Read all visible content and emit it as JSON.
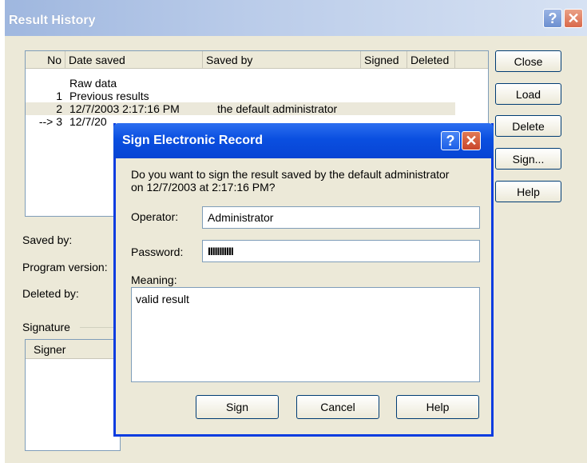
{
  "main_window": {
    "title": "Result History",
    "columns": [
      "No",
      "Date saved",
      "Saved by",
      "Signed",
      "Deleted"
    ],
    "rows": [
      {
        "no": "",
        "date": "Raw data",
        "saved_by": ""
      },
      {
        "no": "1",
        "date": "Previous results",
        "saved_by": ""
      },
      {
        "no": "2",
        "date": "12/7/2003 2:17:16 PM",
        "saved_by": "the default administrator"
      },
      {
        "no": "--> 3",
        "date": "12/7/20",
        "saved_by": ""
      }
    ],
    "buttons": {
      "close": "Close",
      "load": "Load",
      "delete": "Delete",
      "sign": "Sign...",
      "help": "Help"
    },
    "labels": {
      "saved_by": "Saved by:",
      "program_version": "Program version:",
      "deleted_by": "Deleted by:",
      "signature": "Signature"
    },
    "signature_table": {
      "columns": [
        "Signer"
      ]
    }
  },
  "dialog": {
    "title": "Sign Electronic Record",
    "prompt": "Do you want to sign the result saved by the default administrator\non 12/7/2003 at 2:17:16 PM?",
    "operator_label": "Operator:",
    "operator_value": "Administrator",
    "password_label": "Password:",
    "password_value": "IIIIIIIIIII",
    "meaning_label": "Meaning:",
    "meaning_value": "valid result",
    "buttons": {
      "sign": "Sign",
      "cancel": "Cancel",
      "help": "Help"
    }
  },
  "icons": {
    "help": "question-mark-icon",
    "close": "close-x-icon"
  },
  "colors": {
    "dialog_title": "#0a4fe0",
    "window_bg": "#ece9d8",
    "inactive_title": "#a9bfe3"
  }
}
